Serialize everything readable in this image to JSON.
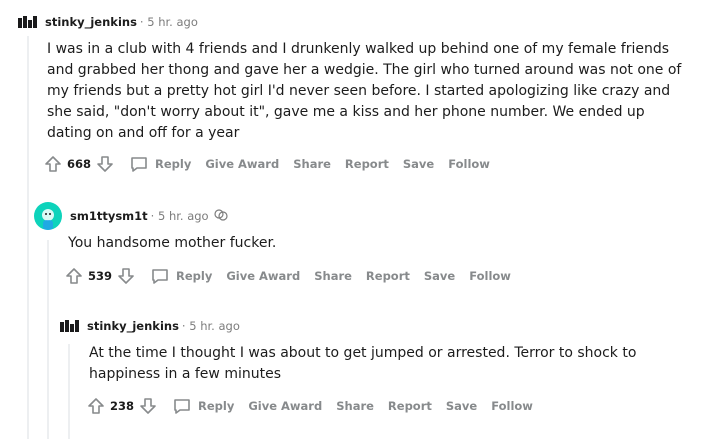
{
  "comments": [
    {
      "username": "stinky_jenkins",
      "time": "· 5 hr. ago",
      "body": "I was in a club with 4 friends and I drunkenly walked up behind one of my female friends and grabbed her thong and gave her a wedgie. The girl who turned around was not one of my friends but a pretty hot girl I'd never seen before. I started apologizing like crazy and she said, \"don't worry about it\", gave me a kiss and her phone number. We ended up dating on and off for a year",
      "score": "668"
    },
    {
      "username": "sm1ttysm1t",
      "time": "· 5 hr. ago",
      "award_icon": "award-icon",
      "body": "You handsome mother fucker.",
      "score": "539"
    },
    {
      "username": "stinky_jenkins",
      "time": "· 5 hr. ago",
      "body": "At the time I thought I was about to get jumped or arrested. Terror to shock to happiness in a few minutes",
      "score": "238"
    }
  ],
  "actions": {
    "reply": "Reply",
    "give_award": "Give Award",
    "share": "Share",
    "report": "Report",
    "save": "Save",
    "follow": "Follow"
  },
  "colors": {
    "avatar_teal": "#0dd3bb",
    "muted": "#878a8c",
    "thread_line": "#edeff1"
  }
}
